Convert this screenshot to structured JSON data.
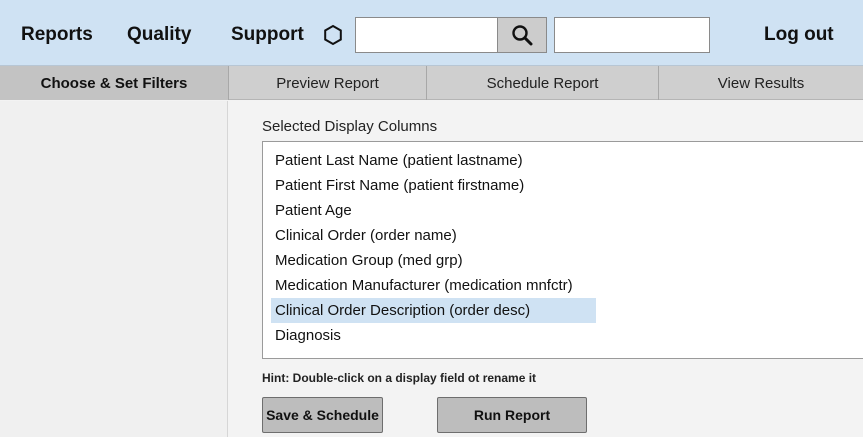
{
  "nav": {
    "items": [
      {
        "label": "Reports"
      },
      {
        "label": "Quality"
      },
      {
        "label": "Support"
      }
    ],
    "search_value": "",
    "second_value": "",
    "logout_label": "Log out"
  },
  "tabs": [
    {
      "label": "Choose & Set Filters",
      "active": true
    },
    {
      "label": "Preview Report"
    },
    {
      "label": "Schedule Report"
    },
    {
      "label": "View Results"
    }
  ],
  "main": {
    "section_label": "Selected Display Columns",
    "columns": [
      "Patient Last Name (patient lastname)",
      "Patient First Name (patient firstname)",
      "Patient Age",
      "Clinical Order (order name)",
      "Medication Group (med grp)",
      "Medication Manufacturer (medication mnfctr)",
      "Clinical Order Description (order desc)",
      "Diagnosis"
    ],
    "selected_index": 6,
    "hint": "Hint: Double-click on a display field ot rename it",
    "save_schedule_label": "Save & Schedule",
    "run_report_label": "Run Report"
  },
  "colors": {
    "topbar": "#cfe2f3",
    "tabbar": "#cfcfcf",
    "selection": "#cfe2f3"
  }
}
